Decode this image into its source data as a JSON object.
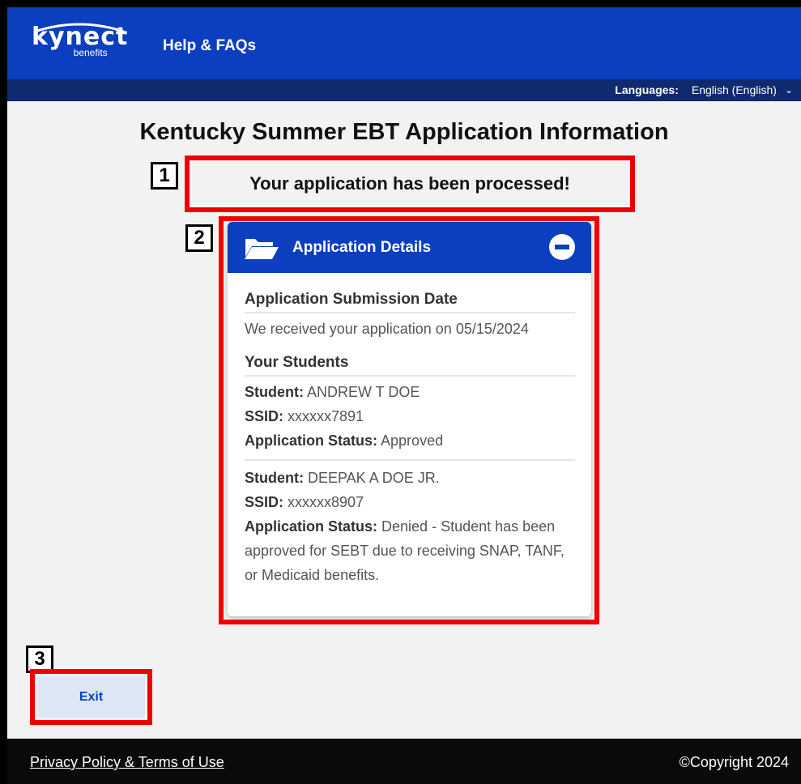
{
  "header": {
    "logo_text": "kynect",
    "logo_subtext": "benefits",
    "help_link": "Help & FAQs"
  },
  "language_bar": {
    "label": "Languages:",
    "selected": "English (English)"
  },
  "page": {
    "title": "Kentucky Summer EBT Application Information",
    "processed_message": "Your application has been processed!"
  },
  "callouts": [
    "1",
    "2",
    "3"
  ],
  "card": {
    "title": "Application Details",
    "submission": {
      "heading": "Application Submission Date",
      "text": "We received your application on 05/15/2024"
    },
    "students_heading": "Your Students",
    "labels": {
      "student": "Student:",
      "ssid": "SSID:",
      "status": "Application Status:"
    },
    "students": [
      {
        "name": "ANDREW T DOE",
        "ssid": "xxxxxx7891",
        "status": "Approved"
      },
      {
        "name": "DEEPAK A DOE JR.",
        "ssid": "xxxxxx8907",
        "status": "Denied - Student has been approved for SEBT due to receiving SNAP, TANF, or Medicaid benefits."
      }
    ]
  },
  "exit_button": "Exit",
  "footer": {
    "privacy_link": "Privacy Policy & Terms of Use",
    "copyright": "©Copyright 2024"
  },
  "colors": {
    "brand_blue": "#0b3fbf",
    "language_bar": "#0f2a6e",
    "highlight_red": "#ee0000",
    "footer": "#0a0a0a"
  }
}
